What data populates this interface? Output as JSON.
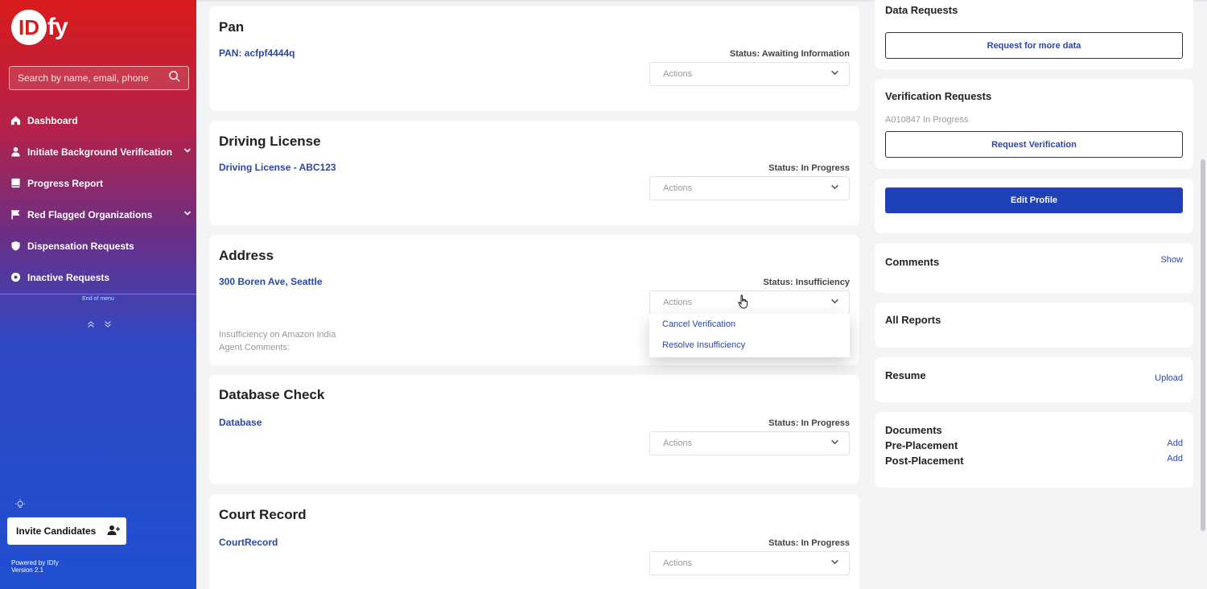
{
  "sidebar": {
    "logo_letter": "ID",
    "logo_suffix": "fy",
    "search_placeholder": "Search by name, email, phone",
    "items": [
      {
        "label": "Dashboard",
        "icon": "home-icon"
      },
      {
        "label": "Initiate Background Verification",
        "icon": "person-icon",
        "expandable": true
      },
      {
        "label": "Progress Report",
        "icon": "book-icon"
      },
      {
        "label": "Red Flagged Organizations",
        "icon": "flag-icon",
        "expandable": true
      },
      {
        "label": "Dispensation Requests",
        "icon": "shield-icon"
      },
      {
        "label": "Inactive Requests",
        "icon": "disc-icon"
      }
    ],
    "end_of_menu": "End of menu",
    "invite_label": "Invite Candidates",
    "powered_by": "Powered by IDfy",
    "version": "Version 2.1"
  },
  "cards": [
    {
      "title": "Pan",
      "link": "PAN: acfpf4444q",
      "status": "Status: Awaiting Information",
      "actions": "Actions"
    },
    {
      "title": "Driving License",
      "link": "Driving License - ABC123",
      "status": "Status: In Progress",
      "actions": "Actions"
    },
    {
      "title": "Address",
      "link": "300 Boren Ave, Seattle",
      "status": "Status: Insufficiency",
      "actions": "Actions",
      "note1": "Insufficiency on Amazon India",
      "note2": "Agent Comments:"
    },
    {
      "title": "Database Check",
      "link": "Database",
      "status": "Status: In Progress",
      "actions": "Actions"
    },
    {
      "title": "Court Record",
      "link": "CourtRecord",
      "status": "Status: In Progress",
      "actions": "Actions"
    }
  ],
  "dropdown": {
    "options": [
      "Cancel Verification",
      "Resolve Insufficiency"
    ]
  },
  "right": {
    "data_requests_title": "Data Requests",
    "request_more_data": "Request for more data",
    "verification_title": "Verification Requests",
    "verification_status": "A010847 In Progress",
    "request_verification": "Request Verification",
    "edit_profile": "Edit Profile",
    "comments_title": "Comments",
    "comments_show": "Show",
    "all_reports_title": "All Reports",
    "resume_title": "Resume",
    "resume_upload": "Upload",
    "documents_title": "Documents",
    "pre_placement": "Pre-Placement",
    "post_placement": "Post-Placement",
    "add_label": "Add"
  },
  "colors": {
    "accent": "#1e40b8",
    "link": "#2a47a8",
    "brand_red": "#d81b1b"
  }
}
